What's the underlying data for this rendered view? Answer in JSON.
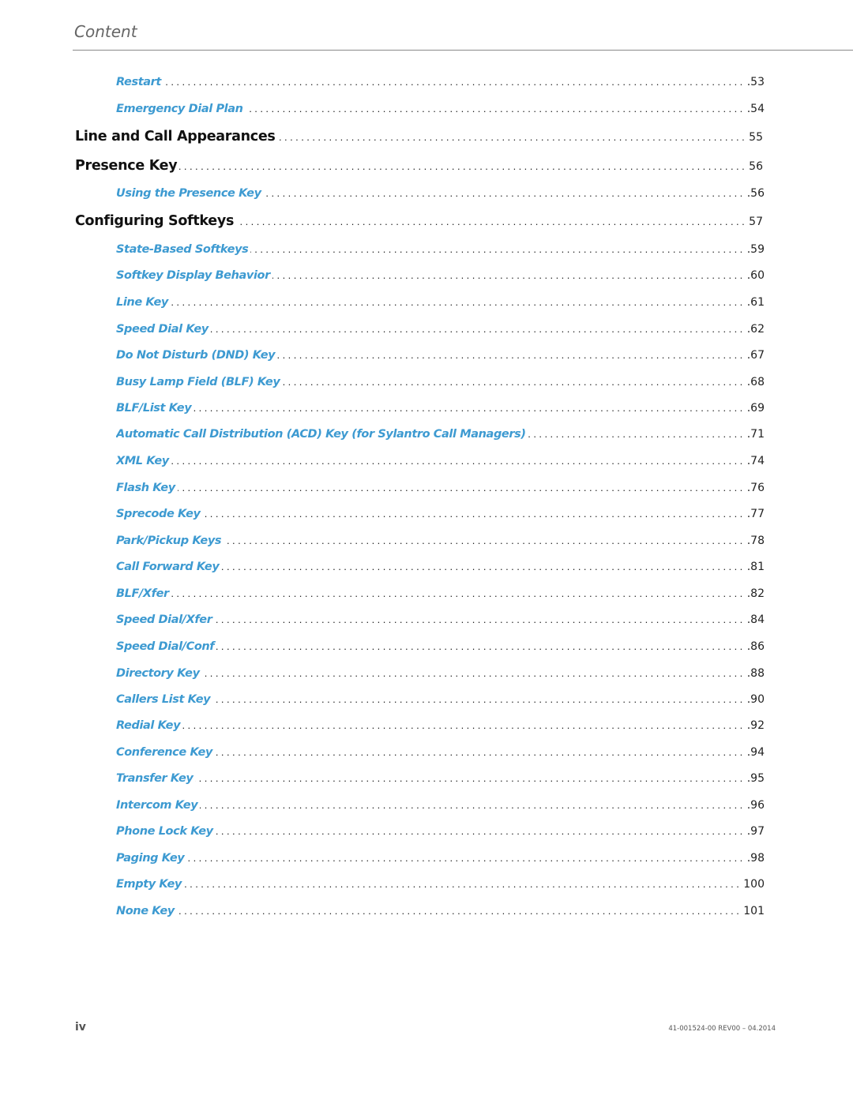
{
  "header": {
    "title": "Content"
  },
  "toc": [
    {
      "title": "Restart",
      "page": ".53",
      "level": 2
    },
    {
      "title": "Emergency Dial Plan",
      "page": ".54",
      "level": 2
    },
    {
      "title": "Line and Call Appearances",
      "page": "55",
      "level": 1
    },
    {
      "title": "Presence Key",
      "page": "56",
      "level": 1
    },
    {
      "title": "Using the Presence Key",
      "page": ".56",
      "level": 2
    },
    {
      "title": "Configuring Softkeys",
      "page": "57",
      "level": 1
    },
    {
      "title": "State-Based Softkeys",
      "page": ".59",
      "level": 2
    },
    {
      "title": "Softkey Display Behavior",
      "page": ".60",
      "level": 2
    },
    {
      "title": "Line Key",
      "page": ".61",
      "level": 2
    },
    {
      "title": "Speed Dial Key",
      "page": ".62",
      "level": 2
    },
    {
      "title": "Do Not Disturb (DND) Key",
      "page": ".67",
      "level": 2
    },
    {
      "title": "Busy Lamp Field (BLF) Key",
      "page": ".68",
      "level": 2
    },
    {
      "title": "BLF/List Key",
      "page": ".69",
      "level": 2
    },
    {
      "title": "Automatic Call Distribution (ACD) Key (for Sylantro Call Managers)",
      "page": ".71",
      "level": 2
    },
    {
      "title": "XML Key",
      "page": ".74",
      "level": 2
    },
    {
      "title": "Flash Key",
      "page": ".76",
      "level": 2
    },
    {
      "title": "Sprecode Key",
      "page": ".77",
      "level": 2
    },
    {
      "title": "Park/Pickup Keys",
      "page": ".78",
      "level": 2
    },
    {
      "title": "Call Forward Key",
      "page": ".81",
      "level": 2
    },
    {
      "title": "BLF/Xfer",
      "page": ".82",
      "level": 2
    },
    {
      "title": "Speed Dial/Xfer",
      "page": ".84",
      "level": 2
    },
    {
      "title": "Speed Dial/Conf",
      "page": ".86",
      "level": 2
    },
    {
      "title": "Directory Key",
      "page": ".88",
      "level": 2
    },
    {
      "title": "Callers List Key",
      "page": ".90",
      "level": 2
    },
    {
      "title": "Redial Key",
      "page": ".92",
      "level": 2
    },
    {
      "title": "Conference Key",
      "page": ".94",
      "level": 2
    },
    {
      "title": "Transfer Key",
      "page": ".95",
      "level": 2
    },
    {
      "title": "Intercom Key",
      "page": ".96",
      "level": 2
    },
    {
      "title": "Phone Lock Key",
      "page": ".97",
      "level": 2
    },
    {
      "title": "Paging Key",
      "page": ".98",
      "level": 2
    },
    {
      "title": "Empty Key",
      "page": "100",
      "level": 2
    },
    {
      "title": "None Key",
      "page": "101",
      "level": 2
    }
  ],
  "footer": {
    "page_number": "iv",
    "doc_id": "41-001524-00 REV00 – 04.2014"
  }
}
